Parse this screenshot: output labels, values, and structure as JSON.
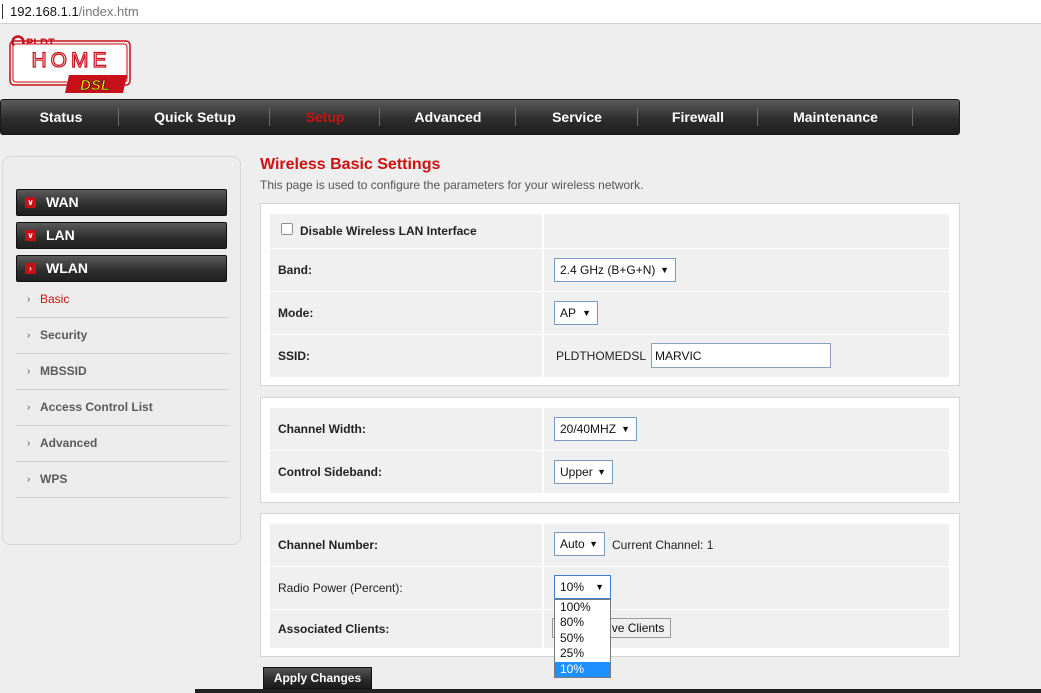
{
  "browser": {
    "address_host": "192.168.1.1",
    "address_path": "/index.htm"
  },
  "logo": {
    "brand_top": "PLDT",
    "brand_home": "HOME",
    "brand_dsl": "DSL"
  },
  "nav": [
    "Status",
    "Quick Setup",
    "Setup",
    "Advanced",
    "Service",
    "Firewall",
    "Maintenance"
  ],
  "nav_active": "Setup",
  "sidebar": {
    "groups": [
      "WAN",
      "LAN",
      "WLAN"
    ],
    "items": [
      "Basic",
      "Security",
      "MBSSID",
      "Access Control List",
      "Advanced",
      "WPS"
    ],
    "active_item": "Basic"
  },
  "page": {
    "title": "Wireless Basic Settings",
    "description": "This page is used to configure the parameters for your wireless network."
  },
  "form": {
    "disable_wlan_label": "Disable Wireless LAN Interface",
    "disable_wlan_checked": false,
    "band_label": "Band:",
    "band_value": "2.4 GHz (B+G+N)",
    "mode_label": "Mode:",
    "mode_value": "AP",
    "ssid_label": "SSID:",
    "ssid_prefix": "PLDTHOMEDSL",
    "ssid_value": "MARVIC",
    "channel_width_label": "Channel Width:",
    "channel_width_value": "20/40MHZ",
    "control_sideband_label": "Control Sideband:",
    "control_sideband_value": "Upper",
    "channel_number_label": "Channel Number:",
    "channel_number_value": "Auto",
    "current_channel_text": "Current Channel: 1",
    "radio_power_label": "Radio Power (Percent):",
    "radio_power_value": "10%",
    "radio_power_options": [
      "100%",
      "80%",
      "50%",
      "25%",
      "10%"
    ],
    "associated_clients_label": "Associated Clients:",
    "show_active_clients_button": "Show Active Clients",
    "apply_button": "Apply Changes"
  },
  "colors": {
    "accent": "#cc1111",
    "nav_bg": "#2e2e2e",
    "highlight": "#1e90ff"
  },
  "icons": {
    "dropdown": "triangle-down-icon",
    "sidebar_collapse": "chevron-down-icon",
    "sidebar_expand": "chevron-right-icon",
    "list_bullet": "bullet-icon"
  }
}
